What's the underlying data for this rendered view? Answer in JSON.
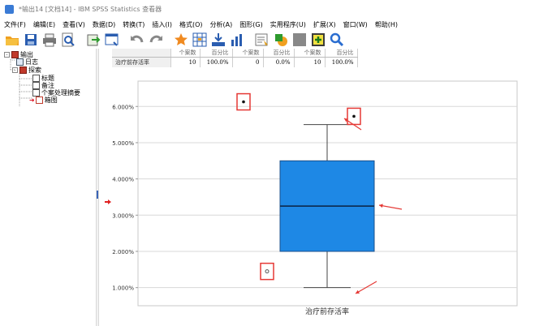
{
  "window": {
    "title": "*输出14 [文档14] - IBM SPSS Statistics 查看器"
  },
  "menu": [
    "文件(F)",
    "编辑(E)",
    "查看(V)",
    "数据(D)",
    "转换(T)",
    "插入(I)",
    "格式(O)",
    "分析(A)",
    "图形(G)",
    "实用程序(U)",
    "扩展(X)",
    "窗口(W)",
    "帮助(H)"
  ],
  "toolbar": {
    "icons": [
      "open-icon",
      "save-icon",
      "print-icon",
      "print-preview-icon",
      "export-icon",
      "recall-dialog-icon",
      "undo-icon",
      "redo-icon",
      "goto-data-icon",
      "goto-variable-icon",
      "insert-output-icon",
      "charts-icon",
      "designate-window-icon",
      "insert-text-icon",
      "pivot-icon",
      "show-all-icon",
      "search-icon"
    ]
  },
  "tree": {
    "root": "输出",
    "log": "日志",
    "explore": "探索",
    "children": [
      "标题",
      "备注",
      "个案处理摘要",
      "箱图"
    ]
  },
  "summary_table": {
    "headers": [
      "个案数",
      "百分比",
      "个案数",
      "百分比",
      "个案数",
      "百分比"
    ],
    "row_label": "治疗前存活率",
    "values": [
      "10",
      "100.0%",
      "0",
      "0.0%",
      "10",
      "100.0%"
    ]
  },
  "chart_data": {
    "type": "boxplot",
    "xlabel": "治疗前存活率",
    "ylabel": "",
    "ylim": [
      0.5,
      6.7
    ],
    "yticks": [
      1,
      2,
      3,
      4,
      5,
      6
    ],
    "ytick_labels": [
      "1.000%",
      "2.000%",
      "3.000%",
      "4.000%",
      "5.000%",
      "6.000%"
    ],
    "box": {
      "whisker_low": 1.0,
      "q1": 2.0,
      "median": 3.25,
      "q3": 4.5,
      "whisker_high": 5.5
    },
    "outliers": [
      6.15,
      5.75,
      1.47
    ],
    "box_color": "#1e88e5",
    "annotation_color": "#e53935"
  }
}
